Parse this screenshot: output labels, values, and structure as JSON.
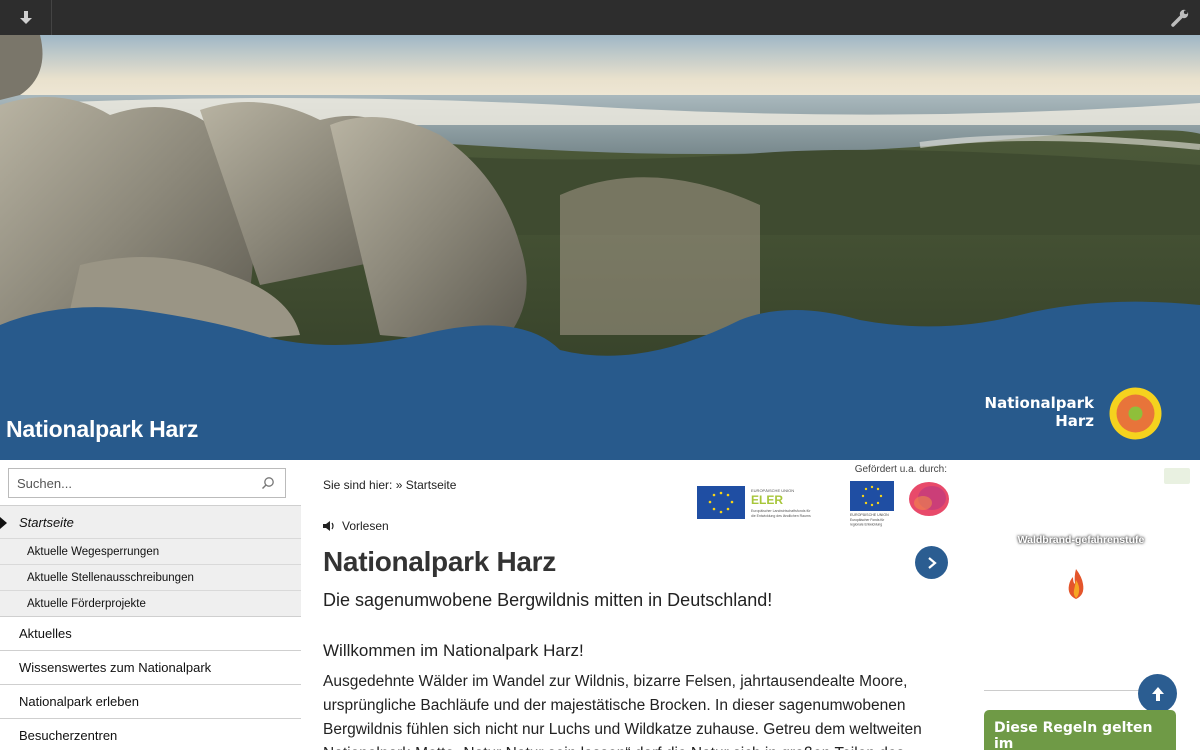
{
  "toolbar": {
    "download_icon": "download-icon",
    "wrench_icon": "wrench-icon"
  },
  "header": {
    "site_title": "Nationalpark Harz",
    "logo_line1": "Nationalpark",
    "logo_line2": "Harz",
    "colors": {
      "blue": "#285a8c",
      "logo_yellow": "#f5d21e",
      "logo_orange": "#e8743a",
      "logo_green": "#8fbf3a"
    }
  },
  "sidebar": {
    "search_placeholder": "Suchen...",
    "items": [
      {
        "label": "Startseite",
        "active": true
      },
      {
        "label": "Aktuelle Wegesperrungen"
      },
      {
        "label": "Aktuelle Stellenausschreibungen"
      },
      {
        "label": "Aktuelle Förderprojekte"
      },
      {
        "label": "Aktuelles"
      },
      {
        "label": "Wissenswertes zum Nationalpark"
      },
      {
        "label": "Nationalpark erleben"
      },
      {
        "label": "Besucherzentren"
      }
    ]
  },
  "main": {
    "breadcrumb_prefix": "Sie sind hier:",
    "breadcrumb_current": "» Startseite",
    "funded_label": "Gefördert u.a. durch:",
    "eler": {
      "union": "EUROPÄISCHE UNION",
      "name": "ELER",
      "line1": "Europäischer Landwirtschaftsfonds für",
      "line2": "die Entwicklung des ländlichen Raums"
    },
    "efre": {
      "union": "EUROPÄISCHE UNION",
      "line1": "Europäischer Fonds für",
      "line2": "regionale Entwicklung"
    },
    "read_aloud": "Vorlesen",
    "title": "Nationalpark Harz",
    "subtitle": "Die sagenumwobene Bergwildnis mitten in Deutschland!",
    "welcome": "Willkommen im Nationalpark Harz!",
    "paragraph": "Ausgedehnte Wälder im Wandel zur Wildnis, bizarre Felsen, jahrtausendealte Moore, ursprüngliche Bachläufe und der majestätische Brocken. In dieser sagenumwobenen Bergwildnis fühlen sich nicht nur Luchs und Wildkatze zuhause. Getreu dem weltweiten Nationalpark-Motto „Natur Natur sein lassen“ darf die Natur sich in großen Teilen des"
  },
  "right": {
    "fire_title": "Waldbrand-gefahrenstufe",
    "rules_text": "Diese Regeln gelten im"
  }
}
